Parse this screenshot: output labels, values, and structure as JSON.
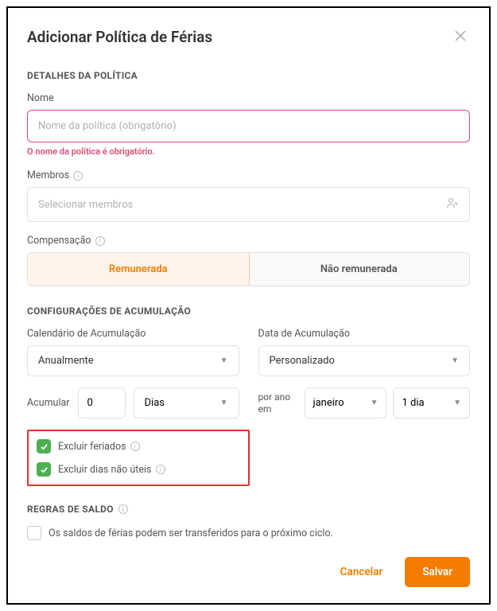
{
  "modal": {
    "title": "Adicionar Política de Férias"
  },
  "sections": {
    "details": "DETALHES DA POLÍTICA",
    "accrual": "CONFIGURAÇÕES DE ACUMULAÇÃO",
    "balance": "REGRAS DE SALDO"
  },
  "fields": {
    "name": {
      "label": "Nome",
      "placeholder": "Nome da política (obrigatório)",
      "error": "O nome da política é obrigatório."
    },
    "members": {
      "label": "Membros",
      "placeholder": "Selecionar membros"
    },
    "compensation": {
      "label": "Compensação",
      "option_paid": "Remunerada",
      "option_unpaid": "Não remunerada"
    },
    "accrual_schedule": {
      "label": "Calendário de Acumulação",
      "value": "Anualmente"
    },
    "accrual_date": {
      "label": "Data de Acumulação",
      "value": "Personalizado"
    },
    "accumulate": {
      "label": "Acumular",
      "value": "0",
      "unit": "Dias"
    },
    "per_year": {
      "label": "por ano em",
      "month": "janeiro",
      "day": "1 dia"
    },
    "exclude_holidays": "Excluir feriados",
    "exclude_nonworking": "Excluir dias não úteis",
    "carryover": "Os saldos de férias podem ser transferidos para o próximo ciclo."
  },
  "buttons": {
    "cancel": "Cancelar",
    "save": "Salvar"
  }
}
